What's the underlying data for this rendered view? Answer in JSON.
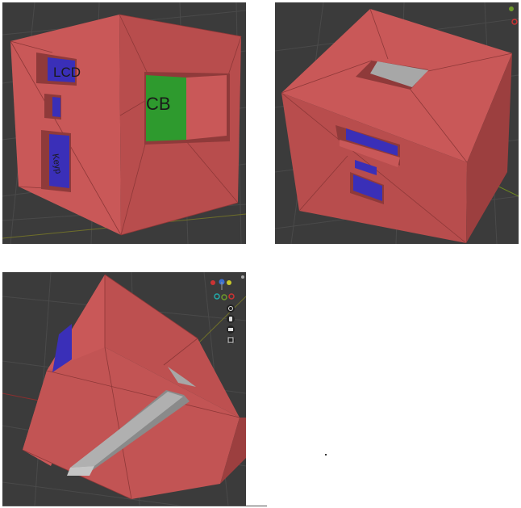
{
  "panels": [
    {
      "id": "view-front",
      "labels": {
        "lcd": "LCD",
        "cb": "CB",
        "keypad": "Keyp"
      }
    },
    {
      "id": "view-top"
    },
    {
      "id": "view-bottom"
    }
  ],
  "colors": {
    "viewport_bg": "#3b3b3b",
    "cube_light": "#cc5a5a",
    "cube_mid": "#b94e4e",
    "cube_dark": "#9c3f3f",
    "cutout_blue": "#3a2fb8",
    "cutout_green": "#2e9a2e",
    "grey_opening": "#a7a7a7",
    "axis_green": "#6f8a1f",
    "axis_red": "#8a2f2f"
  },
  "icons": [
    "navigation-gizmo-icon",
    "zoom-icon",
    "hand-pan-icon",
    "camera-icon",
    "grid-icon"
  ]
}
